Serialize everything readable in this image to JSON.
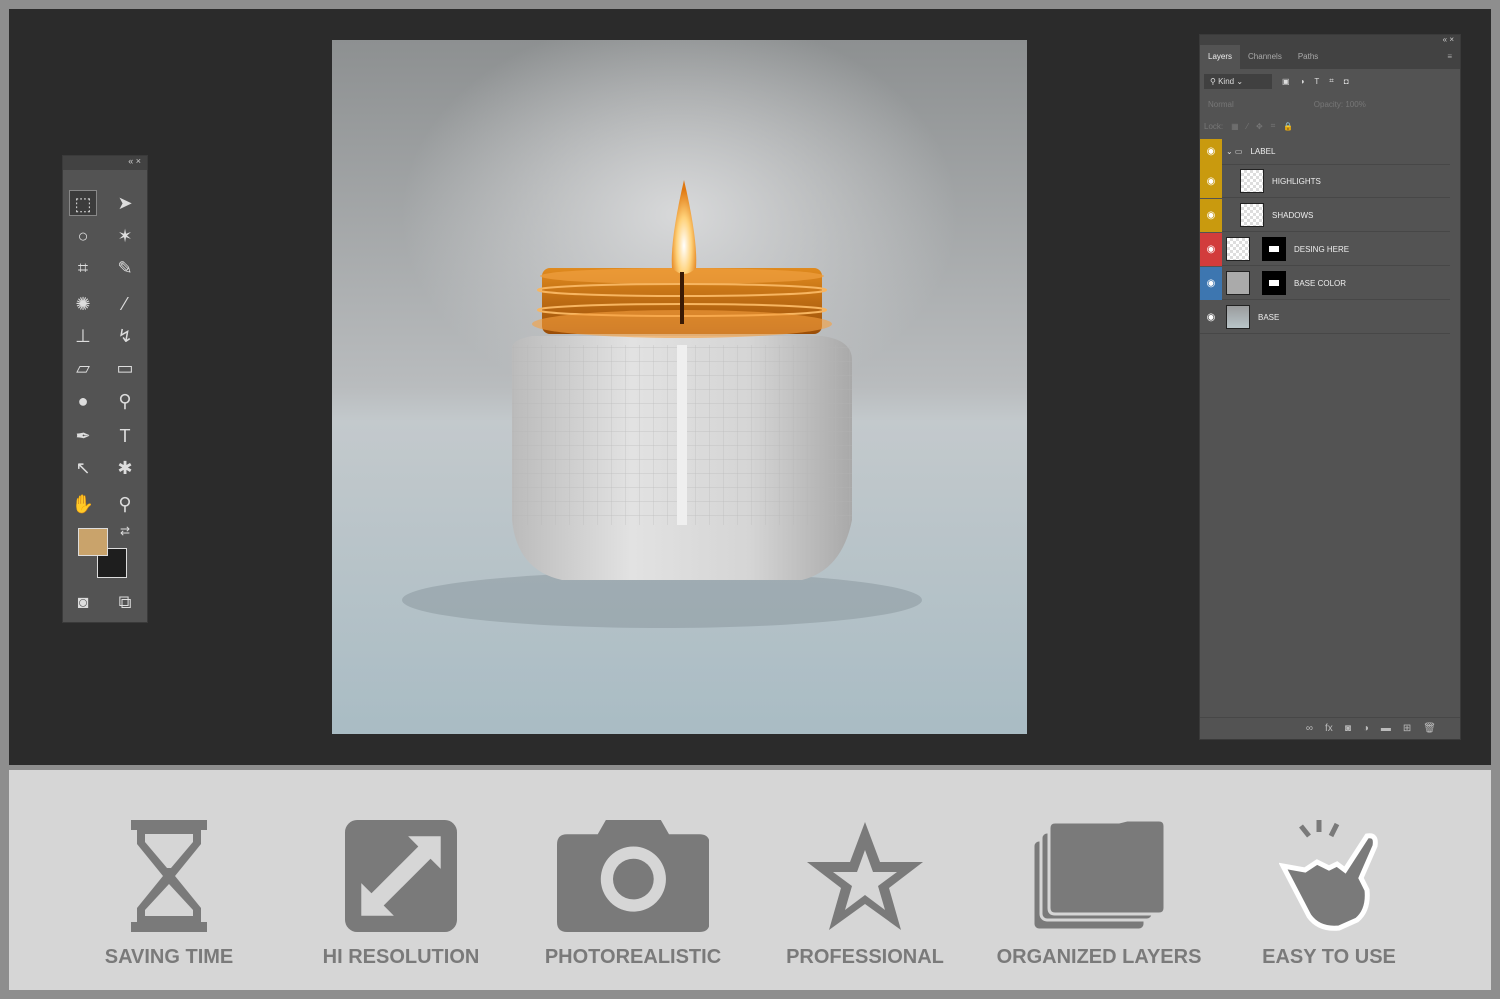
{
  "toolbar": {
    "collapse": "«",
    "close": "×",
    "foreground_color": "#c9a36b",
    "background_color": "#1e1e1e"
  },
  "layers_panel": {
    "collapse": "«",
    "close": "×",
    "tabs": [
      {
        "label": "Layers",
        "active": true
      },
      {
        "label": "Channels"
      },
      {
        "label": "Paths"
      }
    ],
    "filter": "Kind",
    "blend_mode": "Normal",
    "opacity_label": "Opacity:",
    "opacity": "100%",
    "lock_label": "Lock:",
    "layers": [
      {
        "name": "LABEL",
        "type": "group",
        "color": "#c99a0e"
      },
      {
        "name": "HIGHLIGHTS",
        "color": "#c99a0e"
      },
      {
        "name": "SHADOWS",
        "color": "#c99a0e"
      },
      {
        "name": "DESING HERE",
        "color": "#d23c3c",
        "mask": true
      },
      {
        "name": "BASE COLOR",
        "color": "#3d76b0",
        "mask": true
      },
      {
        "name": "BASE",
        "color": "#535353"
      }
    ]
  },
  "features": [
    {
      "label": "SAVING TIME",
      "icon": "hourglass-icon"
    },
    {
      "label": "HI RESOLUTION",
      "icon": "expand-icon"
    },
    {
      "label": "PHOTOREALISTIC",
      "icon": "camera-icon"
    },
    {
      "label": "PROFESSIONAL",
      "icon": "star-icon"
    },
    {
      "label": "ORGANIZED LAYERS",
      "icon": "layers-folder-icon"
    },
    {
      "label": "EASY TO USE",
      "icon": "pointing-hand-icon"
    }
  ]
}
